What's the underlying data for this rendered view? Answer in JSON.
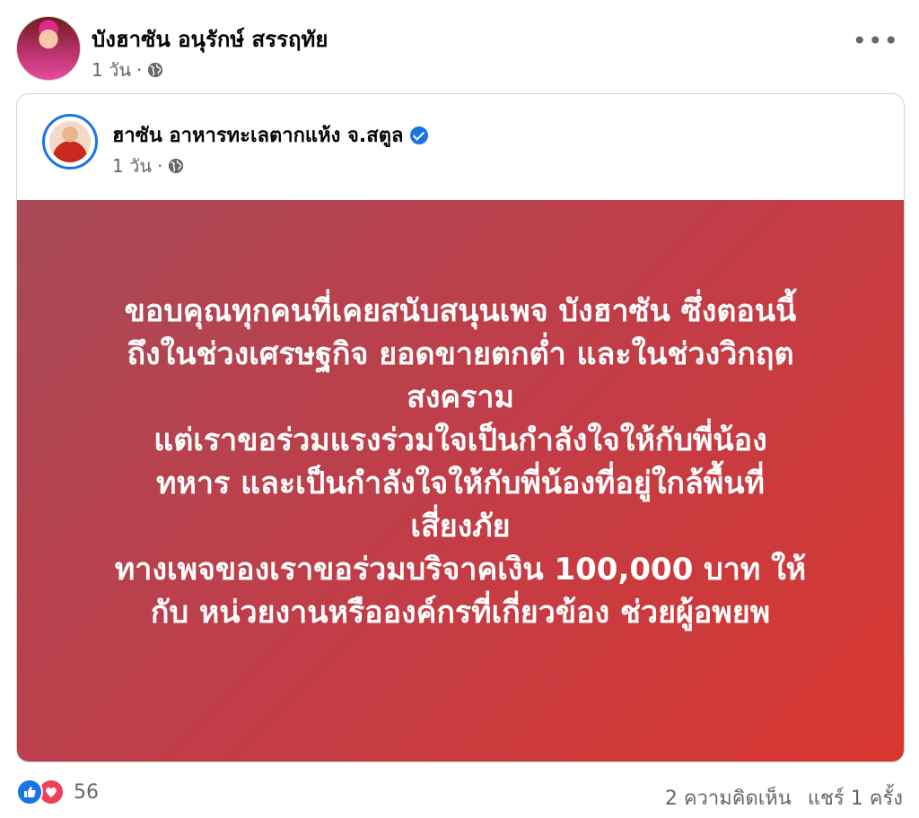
{
  "outer_post": {
    "author": "บังฮาซัน อนุรักษ์ สรรฤทัย",
    "timestamp": "1 วัน",
    "separator": "·",
    "privacy_icon": "globe-icon",
    "more_icon": "more-options-icon",
    "more_label": "•••"
  },
  "shared_post": {
    "page_name": "ฮาซัน อาหารทะเลตากแห้ง จ.สตูล",
    "verified_icon": "verified-badge-icon",
    "timestamp": "1 วัน",
    "separator": "·",
    "privacy_icon": "globe-icon",
    "background_colors": [
      "#a84a57",
      "#d8372f"
    ],
    "text": "ขอบคุณทุกคนที่เคยสนับสนุนเพจ บังฮาซัน ซึ่งตอนนี้\nถึงในช่วงเศรษฐกิจ ยอดขายตกต่ำ และในช่วงวิกฤต\nสงคราม\nแต่เราขอร่วมแรงร่วมใจเป็นกำลังใจให้กับพี่น้อง\nทหาร และเป็นกำลังใจให้กับพี่น้องที่อยู่ใกล้พื้นที่\nเสี่ยงภัย\nทางเพจของเราขอร่วมบริจาคเงิน 100,000 บาท ให้\nกับ หน่วยงานหรือองค์กรที่เกี่ยวข้อง ช่วยผู้อพยพ"
  },
  "footer": {
    "reaction_icons": [
      "like-icon",
      "love-icon"
    ],
    "reaction_count": "56",
    "comments": "2 ความคิดเห็น",
    "shares": "แชร์ 1 ครั้ง"
  },
  "colors": {
    "accent": "#1b74e4",
    "love": "#f33e58",
    "meta_text": "#65676b"
  }
}
